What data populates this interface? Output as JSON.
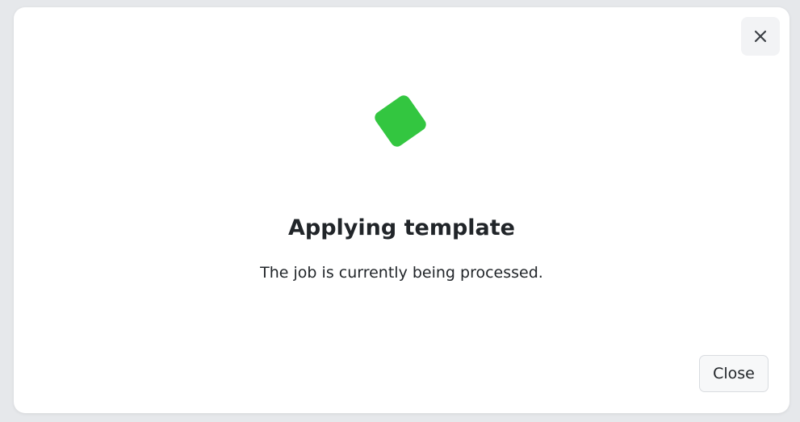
{
  "dialog": {
    "title": "Applying template",
    "message": "The job is currently being processed.",
    "close_button_label": "Close",
    "close_icon": "close-icon",
    "progress_indicator_icon": "loading-spinner-icon"
  },
  "colors": {
    "accent": "#33c640",
    "background": "#e6e8eb",
    "dialog_background": "#ffffff",
    "text": "#212529"
  }
}
